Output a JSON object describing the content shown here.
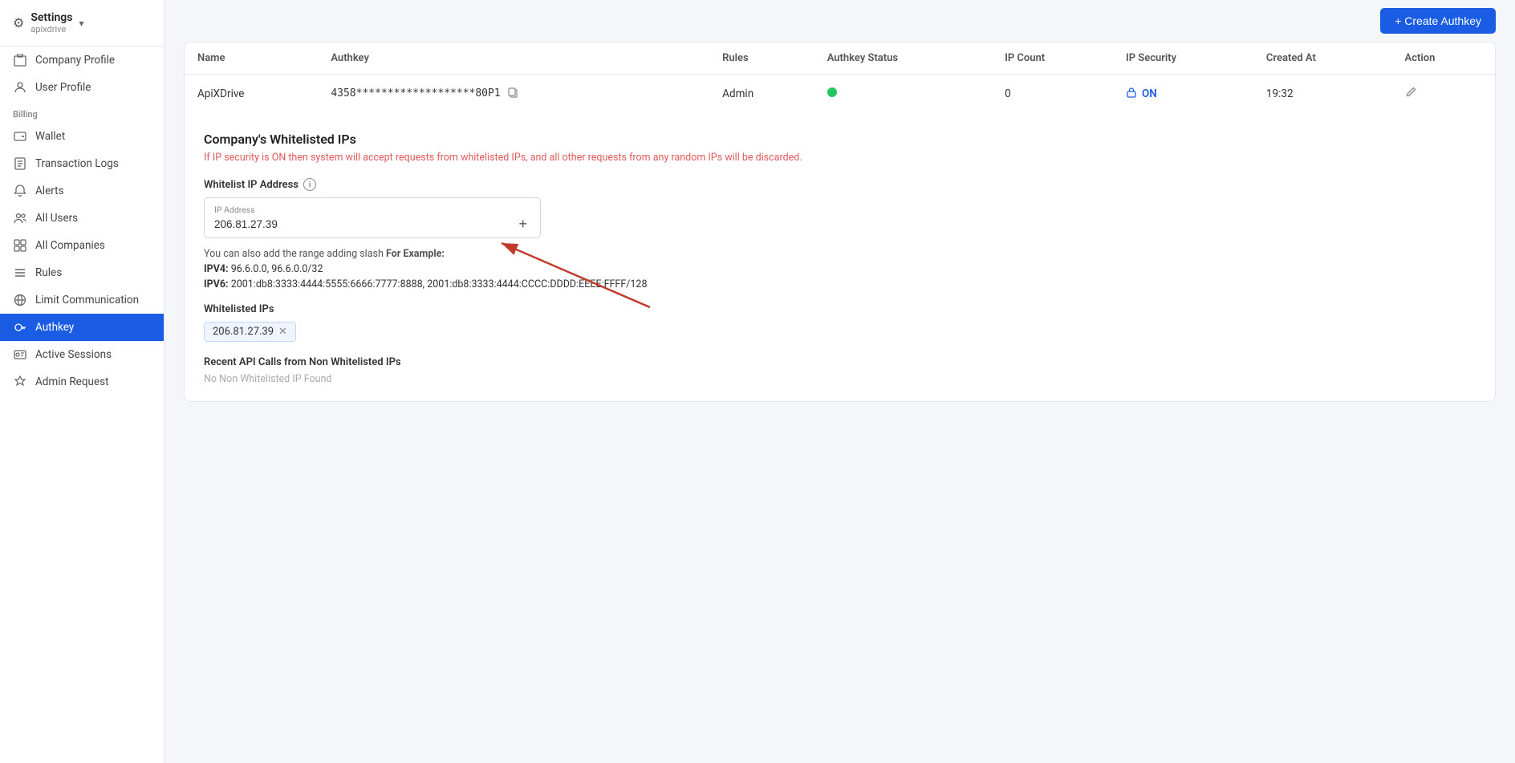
{
  "app": {
    "title": "Settings",
    "subtitle": "apixdrive",
    "dropdown_icon": "▾"
  },
  "sidebar": {
    "billing_label": "Billing",
    "items": [
      {
        "id": "company-profile",
        "label": "Company Profile",
        "icon": "🏢",
        "active": false
      },
      {
        "id": "user-profile",
        "label": "User Profile",
        "icon": "👤",
        "active": false
      },
      {
        "id": "wallet",
        "label": "Wallet",
        "icon": "🪪",
        "active": false
      },
      {
        "id": "transaction-logs",
        "label": "Transaction Logs",
        "icon": "📋",
        "active": false
      },
      {
        "id": "alerts",
        "label": "Alerts",
        "icon": "🔔",
        "active": false
      },
      {
        "id": "all-users",
        "label": "All Users",
        "icon": "👥",
        "active": false
      },
      {
        "id": "all-companies",
        "label": "All Companies",
        "icon": "🗂️",
        "active": false
      },
      {
        "id": "rules",
        "label": "Rules",
        "icon": "☰",
        "active": false
      },
      {
        "id": "limit-communication",
        "label": "Limit Communication",
        "icon": "🌐",
        "active": false
      },
      {
        "id": "authkey",
        "label": "Authkey",
        "icon": "🔑",
        "active": true
      },
      {
        "id": "active-sessions",
        "label": "Active Sessions",
        "icon": "🔗",
        "active": false
      },
      {
        "id": "admin-request",
        "label": "Admin Request",
        "icon": "🛡️",
        "active": false
      }
    ]
  },
  "topbar": {
    "create_btn_label": "+ Create Authkey"
  },
  "table": {
    "columns": [
      "Name",
      "Authkey",
      "Rules",
      "Authkey Status",
      "IP Count",
      "IP Security",
      "Created At",
      "Action"
    ],
    "rows": [
      {
        "name": "ApiXDrive",
        "authkey": "4358*******************80P1",
        "rules": "Admin",
        "status": "active",
        "ip_count": "0",
        "ip_security": "ON",
        "created_at": "19:32",
        "action": "edit"
      }
    ]
  },
  "whitelist": {
    "section_title": "Company's Whitelisted IPs",
    "info_text": "If IP security is ON then system will accept requests from whitelisted IPs, and all other requests from any random IPs will be discarded.",
    "ip_label": "Whitelist IP Address",
    "input_label": "IP Address",
    "input_value": "206.81.27.39",
    "hint_text": "You can also add the range adding slash",
    "hint_bold": "For Example:",
    "hint_ipv4_label": "IPV4:",
    "hint_ipv4_value": "96.6.0.0, 96.6.0.0/32",
    "hint_ipv6_label": "IPV6:",
    "hint_ipv6_value": "2001:db8:3333:4444:5555:6666:7777:8888, 2001:db8:3333:4444:CCCC:DDDD:EEEE:FFFF/128",
    "whitelisted_ips_title": "Whitelisted IPs",
    "whitelisted_ip_tag": "206.81.27.39",
    "recent_api_title": "Recent API Calls from Non Whitelisted IPs",
    "no_data_text": "No Non Whitelisted IP Found"
  }
}
